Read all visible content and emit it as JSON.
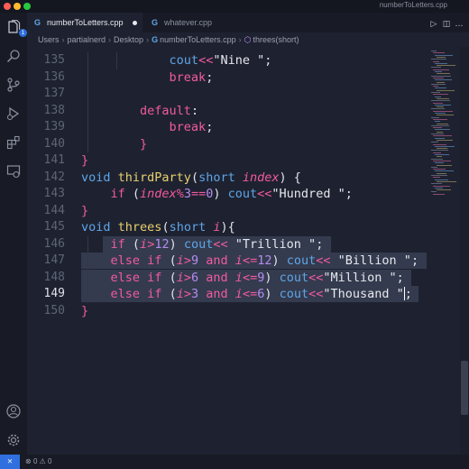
{
  "window": {
    "title": "numberToLetters.cpp"
  },
  "activity_bar": {
    "explorer_badge": "1"
  },
  "tabs": [
    {
      "label": "numberToLetters.cpp",
      "icon": "cpp-file-icon",
      "active": true,
      "dirty": true
    },
    {
      "label": "whatever.cpp",
      "icon": "cpp-file-icon",
      "active": false
    }
  ],
  "breadcrumb": {
    "items": [
      "Users",
      "partialnerd",
      "Desktop",
      "numberToLetters.cpp",
      "threes(short)"
    ]
  },
  "editor": {
    "current_line": "149",
    "lines": [
      {
        "n": "135",
        "indent": 3,
        "tokens": [
          [
            "out",
            "cout"
          ],
          [
            "op",
            "<<"
          ],
          [
            "str",
            "\"Nine \""
          ],
          [
            "plain",
            ";"
          ]
        ]
      },
      {
        "n": "136",
        "indent": 3,
        "tokens": [
          [
            "kw",
            "break"
          ],
          [
            "plain",
            ";"
          ]
        ]
      },
      {
        "n": "137",
        "indent": 0,
        "tokens": []
      },
      {
        "n": "138",
        "indent": 2,
        "tokens": [
          [
            "kw",
            "default"
          ],
          [
            "plain",
            ":"
          ]
        ]
      },
      {
        "n": "139",
        "indent": 3,
        "tokens": [
          [
            "kw",
            "break"
          ],
          [
            "plain",
            ";"
          ]
        ]
      },
      {
        "n": "140",
        "indent": 2,
        "tokens": [
          [
            "brace",
            "}"
          ]
        ]
      },
      {
        "n": "141",
        "indent": 0,
        "tokens": [
          [
            "brace",
            "}"
          ]
        ]
      },
      {
        "n": "142",
        "indent": 0,
        "tokens": [
          [
            "kwb",
            "void"
          ],
          [
            "plain",
            " "
          ],
          [
            "fn",
            "thirdParty"
          ],
          [
            "plain",
            "("
          ],
          [
            "kwb",
            "short"
          ],
          [
            "plain",
            " "
          ],
          [
            "id",
            "index"
          ],
          [
            "plain",
            ") {"
          ]
        ]
      },
      {
        "n": "143",
        "indent": 1,
        "tokens": [
          [
            "kw",
            "if"
          ],
          [
            "plain",
            " ("
          ],
          [
            "id",
            "index"
          ],
          [
            "op",
            "%"
          ],
          [
            "num",
            "3"
          ],
          [
            "op",
            "=="
          ],
          [
            "num",
            "0"
          ],
          [
            "plain",
            ") "
          ],
          [
            "out",
            "cout"
          ],
          [
            "op",
            "<<"
          ],
          [
            "str",
            "\"Hundred \""
          ],
          [
            "plain",
            ";"
          ]
        ]
      },
      {
        "n": "144",
        "indent": 0,
        "tokens": [
          [
            "brace",
            "}"
          ]
        ]
      },
      {
        "n": "145",
        "indent": 0,
        "tokens": [
          [
            "kwb",
            "void"
          ],
          [
            "plain",
            " "
          ],
          [
            "fn",
            "threes"
          ],
          [
            "plain",
            "("
          ],
          [
            "kwb",
            "short"
          ],
          [
            "plain",
            " "
          ],
          [
            "id",
            "i"
          ],
          [
            "plain",
            "){"
          ]
        ]
      },
      {
        "n": "146",
        "indent": 1,
        "tokens": [
          [
            "kw",
            "if"
          ],
          [
            "plain",
            " ("
          ],
          [
            "id",
            "i"
          ],
          [
            "op",
            ">"
          ],
          [
            "num",
            "12"
          ],
          [
            "plain",
            ") "
          ],
          [
            "out",
            "cout"
          ],
          [
            "op",
            "<<"
          ],
          [
            "plain",
            " "
          ],
          [
            "str",
            "\"Trillion \""
          ],
          [
            "plain",
            ";"
          ]
        ]
      },
      {
        "n": "147",
        "indent": 1,
        "tokens": [
          [
            "kw",
            "else"
          ],
          [
            "plain",
            " "
          ],
          [
            "kw",
            "if"
          ],
          [
            "plain",
            " ("
          ],
          [
            "id",
            "i"
          ],
          [
            "op",
            ">"
          ],
          [
            "num",
            "9"
          ],
          [
            "plain",
            " "
          ],
          [
            "kw",
            "and"
          ],
          [
            "plain",
            " "
          ],
          [
            "id",
            "i"
          ],
          [
            "op",
            "<="
          ],
          [
            "num",
            "12"
          ],
          [
            "plain",
            ") "
          ],
          [
            "out",
            "cout"
          ],
          [
            "op",
            "<<"
          ],
          [
            "plain",
            " "
          ],
          [
            "str",
            "\"Billion \""
          ],
          [
            "plain",
            ";"
          ]
        ]
      },
      {
        "n": "148",
        "indent": 1,
        "tokens": [
          [
            "kw",
            "else"
          ],
          [
            "plain",
            " "
          ],
          [
            "kw",
            "if"
          ],
          [
            "plain",
            " ("
          ],
          [
            "id",
            "i"
          ],
          [
            "op",
            ">"
          ],
          [
            "num",
            "6"
          ],
          [
            "plain",
            " "
          ],
          [
            "kw",
            "and"
          ],
          [
            "plain",
            " "
          ],
          [
            "id",
            "i"
          ],
          [
            "op",
            "<="
          ],
          [
            "num",
            "9"
          ],
          [
            "plain",
            ") "
          ],
          [
            "out",
            "cout"
          ],
          [
            "op",
            "<<"
          ],
          [
            "str",
            "\"Million \""
          ],
          [
            "plain",
            ";"
          ]
        ]
      },
      {
        "n": "149",
        "indent": 1,
        "tokens": [
          [
            "kw",
            "else"
          ],
          [
            "plain",
            " "
          ],
          [
            "kw",
            "if"
          ],
          [
            "plain",
            " ("
          ],
          [
            "id",
            "i"
          ],
          [
            "op",
            ">"
          ],
          [
            "num",
            "3"
          ],
          [
            "plain",
            " "
          ],
          [
            "kw",
            "and"
          ],
          [
            "plain",
            " "
          ],
          [
            "id",
            "i"
          ],
          [
            "op",
            "<="
          ],
          [
            "num",
            "6"
          ],
          [
            "plain",
            ") "
          ],
          [
            "out",
            "cout"
          ],
          [
            "op",
            "<<"
          ],
          [
            "str",
            "\"Thousand \""
          ],
          [
            "caret",
            ""
          ],
          [
            "plain",
            ";"
          ]
        ]
      },
      {
        "n": "150",
        "indent": 0,
        "tokens": [
          [
            "brace",
            "}"
          ]
        ]
      }
    ]
  },
  "status_bar": {
    "errors": "0",
    "warnings": "0"
  },
  "colors": {
    "accent": "#2f6fe0",
    "editor_bg": "#1e2230",
    "selection": "#343b4e"
  }
}
